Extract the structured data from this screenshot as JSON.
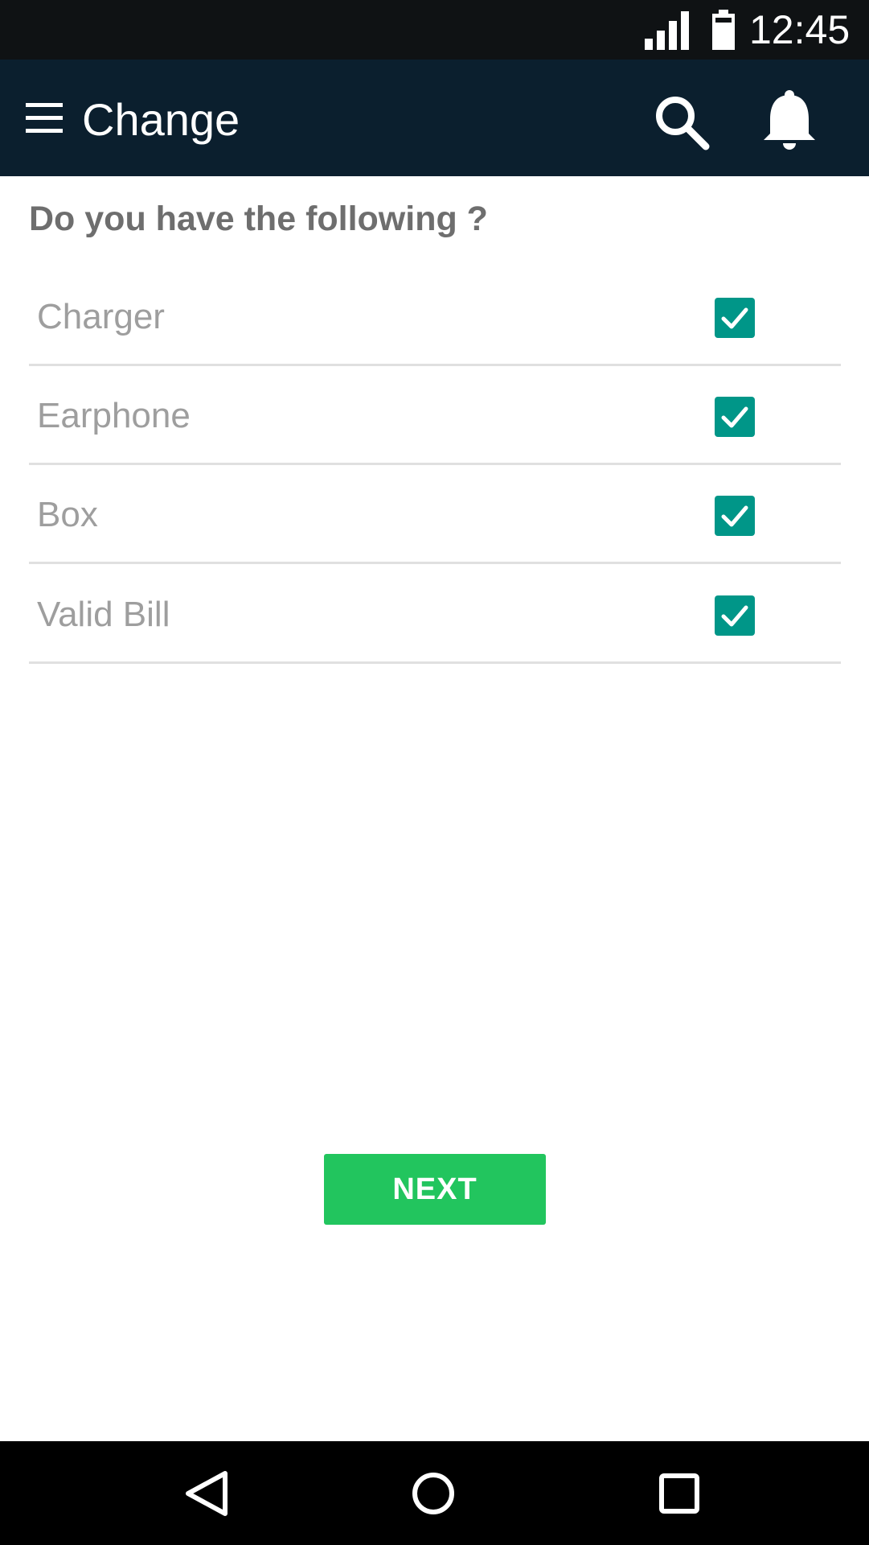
{
  "status_bar": {
    "time": "12:45",
    "signal_icon": "signal-icon",
    "battery_icon": "battery-icon"
  },
  "app_bar": {
    "title": "Change",
    "menu_icon": "hamburger-menu-icon",
    "search_icon": "search-icon",
    "notification_icon": "bell-icon",
    "background_color": "#0b1f2e"
  },
  "content": {
    "question": "Do you have the following ?",
    "items": [
      {
        "label": "Charger",
        "checked": true
      },
      {
        "label": "Earphone",
        "checked": true
      },
      {
        "label": "Box",
        "checked": true
      },
      {
        "label": "Valid Bill",
        "checked": true
      }
    ],
    "checkbox_color": "#009688"
  },
  "actions": {
    "next_label": "NEXT",
    "next_color": "#22c55e"
  },
  "nav_bar": {
    "back_icon": "back-triangle-icon",
    "home_icon": "home-circle-icon",
    "recents_icon": "recents-square-icon"
  }
}
